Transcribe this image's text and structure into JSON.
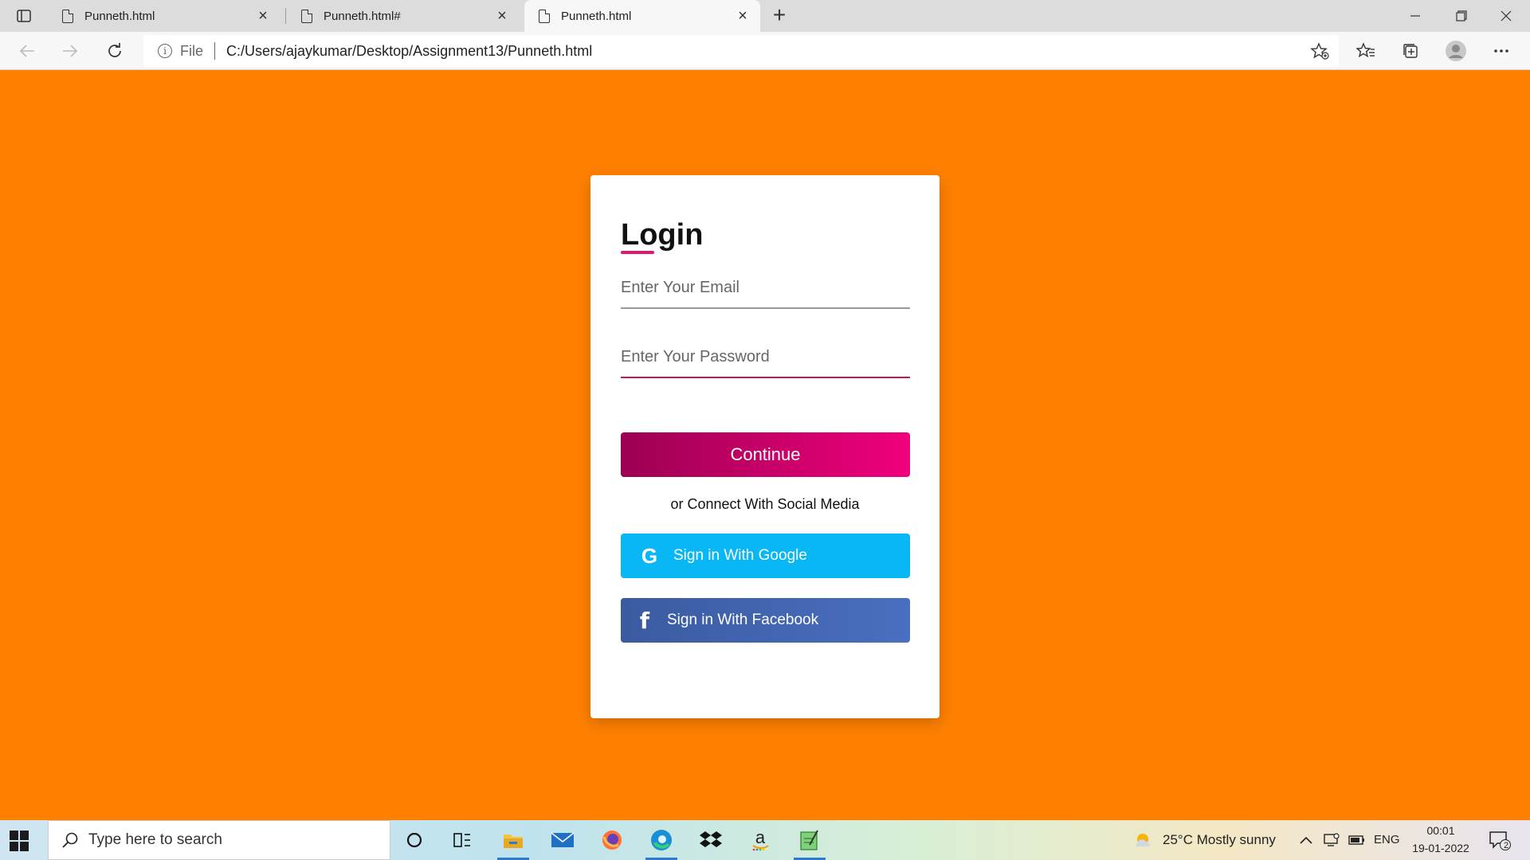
{
  "browser": {
    "tabs": [
      {
        "title": "Punneth.html",
        "active": false
      },
      {
        "title": "Punneth.html#",
        "active": false
      },
      {
        "title": "Punneth.html",
        "active": true
      }
    ],
    "address": {
      "scheme_label": "File",
      "url": "C:/Users/ajaykumar/Desktop/Assignment13/Punneth.html"
    }
  },
  "login": {
    "title": "Login",
    "email_placeholder": "Enter Your Email",
    "password_placeholder": "Enter Your Password",
    "continue_label": "Continue",
    "social_caption": "or Connect With Social Media",
    "google_label": "Sign in With Google",
    "facebook_label": "Sign in With Facebook",
    "google_glyph": "G",
    "facebook_glyph": "f"
  },
  "colors": {
    "page_background": "#ff8000",
    "continue_gradient_start": "#9c0052",
    "continue_gradient_end": "#f0007c",
    "google_button": "#0ab7f5",
    "facebook_button": "#3a5ba0"
  },
  "taskbar": {
    "search_placeholder": "Type here to search",
    "weather": "25°C  Mostly sunny",
    "language": "ENG",
    "time": "00:01",
    "date": "19-01-2022",
    "notification_count": "2",
    "pinned_apps": [
      "cortana-icon",
      "task-view-icon",
      "file-explorer-icon",
      "mail-icon",
      "firefox-icon",
      "edge-icon",
      "dropbox-icon",
      "amazon-icon",
      "notepad-icon"
    ]
  }
}
